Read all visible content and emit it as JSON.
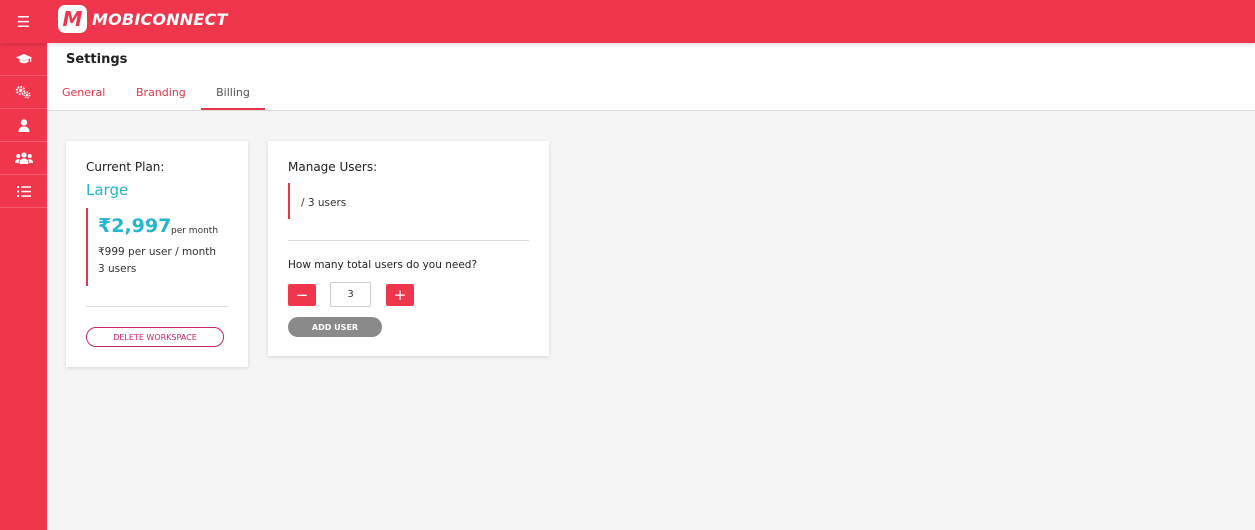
{
  "app": {
    "logo_letter": "M",
    "name": "MOBICONNECT",
    "menu_icon": "☰"
  },
  "sidebar": {
    "items": [
      {
        "name": "graduation-cap-icon"
      },
      {
        "name": "gears-icon"
      },
      {
        "name": "user-icon"
      },
      {
        "name": "users-group-icon"
      },
      {
        "name": "list-icon"
      }
    ]
  },
  "header": {
    "title": "Settings",
    "tabs": [
      {
        "label": "General"
      },
      {
        "label": "Branding"
      },
      {
        "label": "Billing",
        "active": true
      }
    ]
  },
  "plan": {
    "label": "Current Plan:",
    "name": "Large",
    "price": "₹2,997",
    "period": "per month",
    "per_user": "₹999 per user / month",
    "users": "3 users",
    "delete_label": "DELETE WORKSPACE"
  },
  "manage": {
    "label": "Manage Users:",
    "summary": "/ 3 users",
    "question": "How many total users do you need?",
    "minus": "−",
    "quantity": "3",
    "plus": "+",
    "add_label": "ADD USER"
  },
  "colors": {
    "brand": "#f0364d",
    "accent": "#22b6cf",
    "neutral_button": "#8a8a8a"
  }
}
